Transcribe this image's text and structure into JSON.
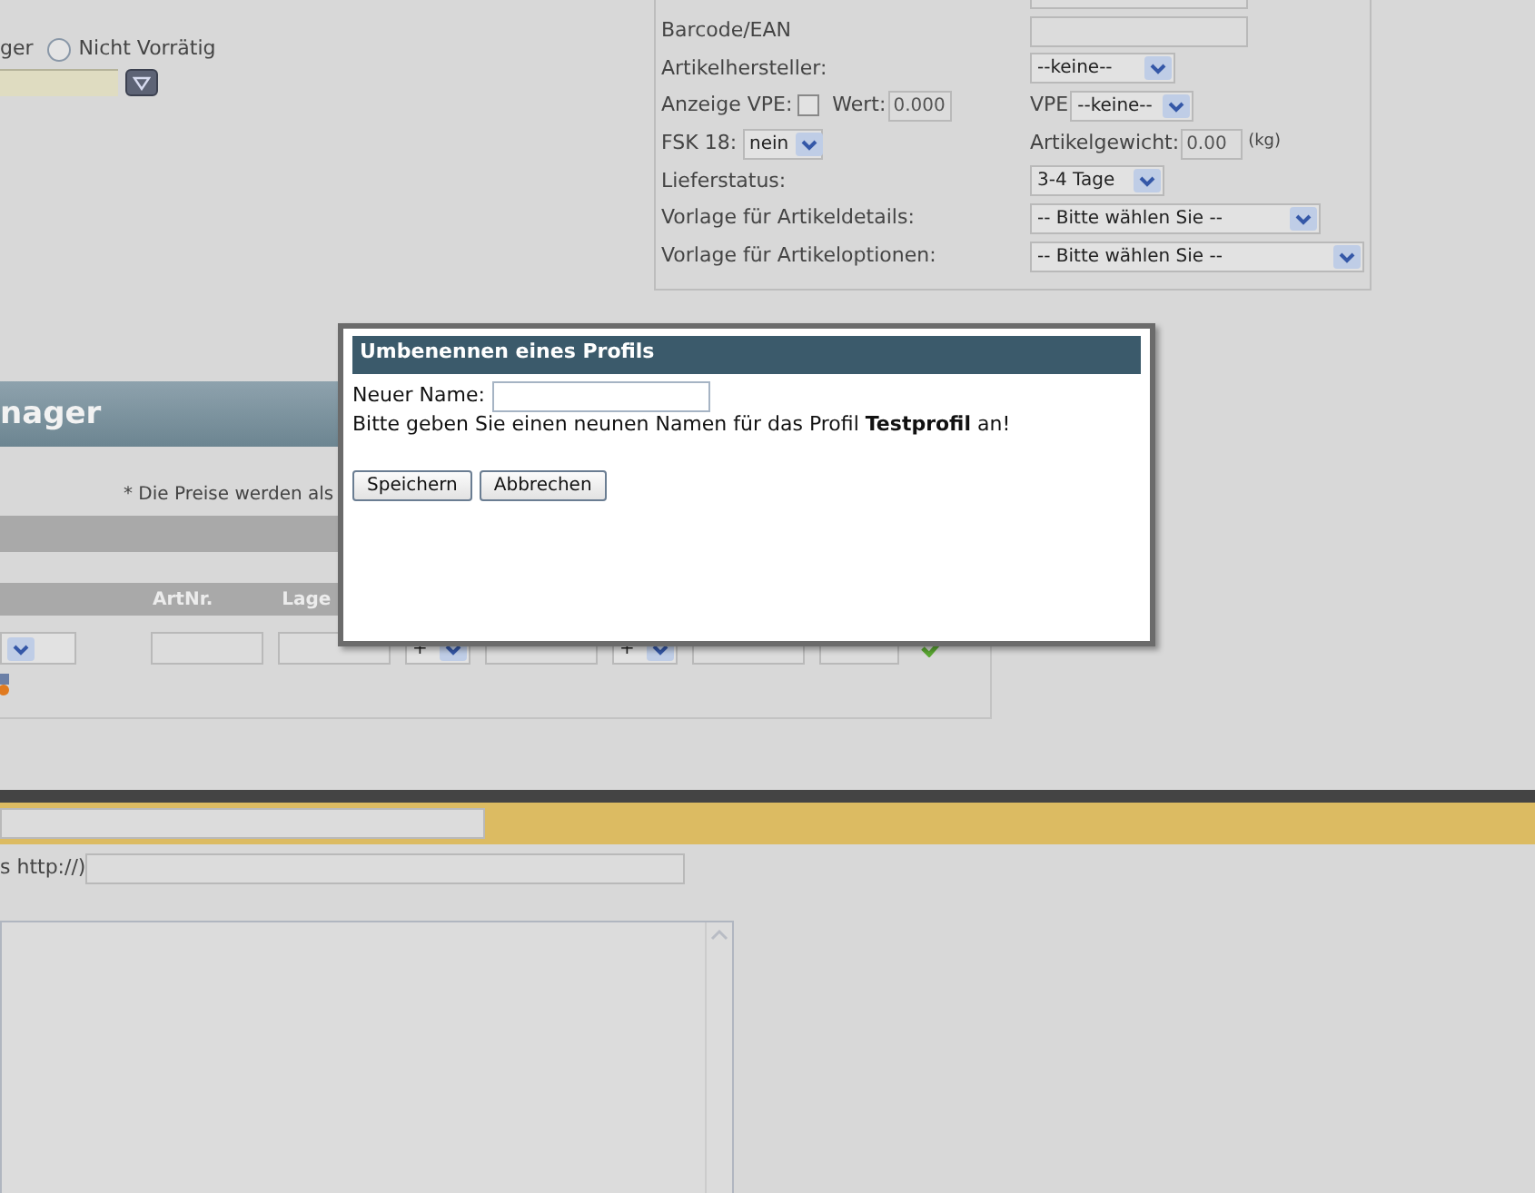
{
  "stock_options": {
    "cut_label": "ger",
    "radio": {
      "label": "Nicht Vorrätig",
      "selected": false
    }
  },
  "article_form": {
    "rows": [
      {
        "kind": "input",
        "label": "Barcode/EAN",
        "value": ""
      },
      {
        "kind": "select",
        "label": "Artikelhersteller:",
        "value": "--keine--"
      },
      {
        "kind": "vpe",
        "label": "Anzeige VPE:",
        "checked": false,
        "value_label": "Wert:",
        "value": "0.000",
        "right_label": "VPE",
        "right_value": "--keine--"
      },
      {
        "kind": "fsk",
        "label": "FSK 18:",
        "value": "nein",
        "right_label": "Artikelgewicht:",
        "right_value": "0.00",
        "unit": "(kg)"
      },
      {
        "kind": "select",
        "label": "Lieferstatus:",
        "value": "3-4 Tage"
      },
      {
        "kind": "select",
        "label": "Vorlage für Artikeldetails:",
        "value": "-- Bitte wählen Sie --"
      },
      {
        "kind": "wide_select",
        "label": "Vorlage für Artikeloptionen:",
        "value": "-- Bitte wählen Sie --"
      }
    ]
  },
  "manager_panel": {
    "title": "nager",
    "note": "* Die Preise werden als",
    "columns": [
      "ArtNr.",
      "Lage"
    ],
    "operators": [
      "+",
      "+"
    ]
  },
  "url_row": {
    "label": "s http://)"
  },
  "dialog": {
    "title": "Umbenennen eines Profils",
    "name_label": "Neuer Name:",
    "message": "Bitte geben Sie einen neunen Namen für das Profil **Testprofil** an!",
    "buttons": [
      "Speichern",
      "Abbrechen"
    ]
  }
}
